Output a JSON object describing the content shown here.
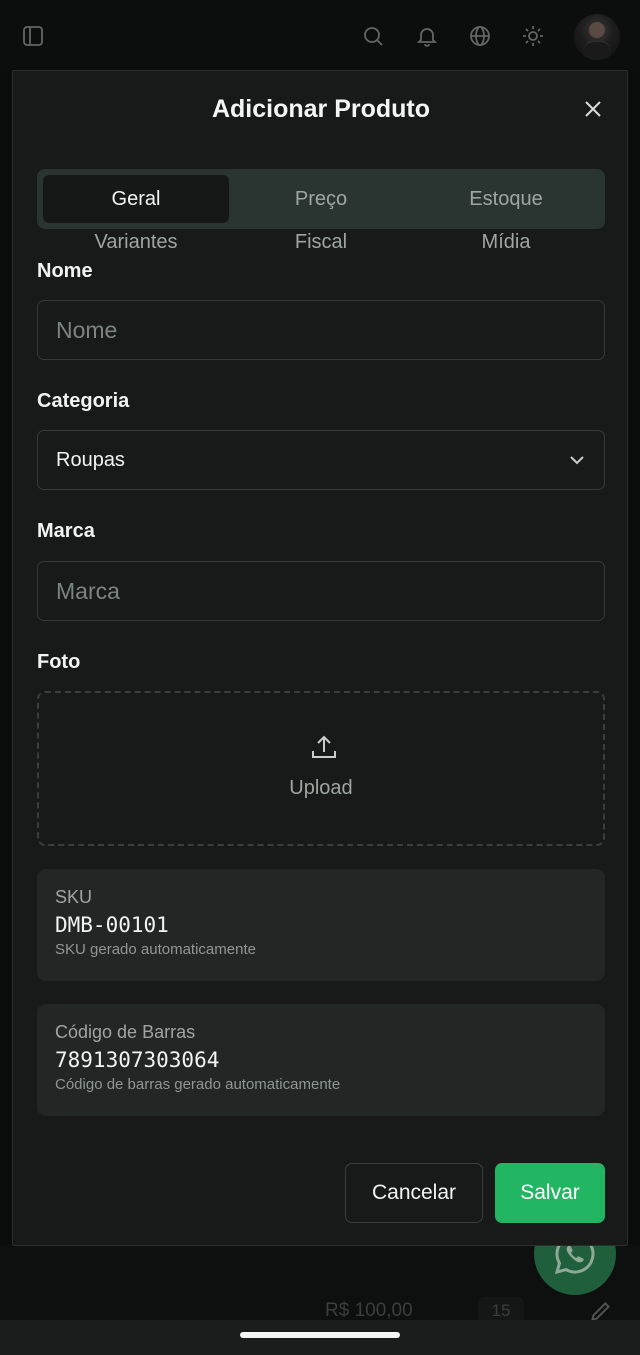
{
  "colors": {
    "background": "#0b0c0c",
    "modal": "#171a19",
    "accent": "#22b562",
    "tabs_bg": "#2a3532"
  },
  "topbar": {
    "icons": [
      "sidebar-toggle-icon",
      "search-icon",
      "bell-icon",
      "globe-icon",
      "sun-icon"
    ]
  },
  "modal": {
    "title": "Adicionar Produto",
    "close_icon": "close-icon",
    "tabs": [
      {
        "label": "Geral",
        "active": true
      },
      {
        "label": "Preço",
        "active": false
      },
      {
        "label": "Estoque",
        "active": false
      },
      {
        "label": "Variantes",
        "active": false
      },
      {
        "label": "Fiscal",
        "active": false
      },
      {
        "label": "Mídia",
        "active": false
      }
    ],
    "fields": {
      "nome": {
        "label": "Nome",
        "placeholder": "Nome",
        "value": ""
      },
      "categoria": {
        "label": "Categoria",
        "value": "Roupas"
      },
      "marca": {
        "label": "Marca",
        "placeholder": "Marca",
        "value": ""
      },
      "foto": {
        "label": "Foto",
        "upload_text": "Upload"
      }
    },
    "sku": {
      "title": "SKU",
      "value": "DMB-00101",
      "hint": "SKU gerado automaticamente"
    },
    "barcode": {
      "title": "Código de Barras",
      "value": "7891307303064",
      "hint": "Código de barras gerado automaticamente"
    },
    "buttons": {
      "cancel": "Cancelar",
      "save": "Salvar"
    }
  },
  "background_page": {
    "price": "R$ 100,00",
    "qty": "15"
  }
}
